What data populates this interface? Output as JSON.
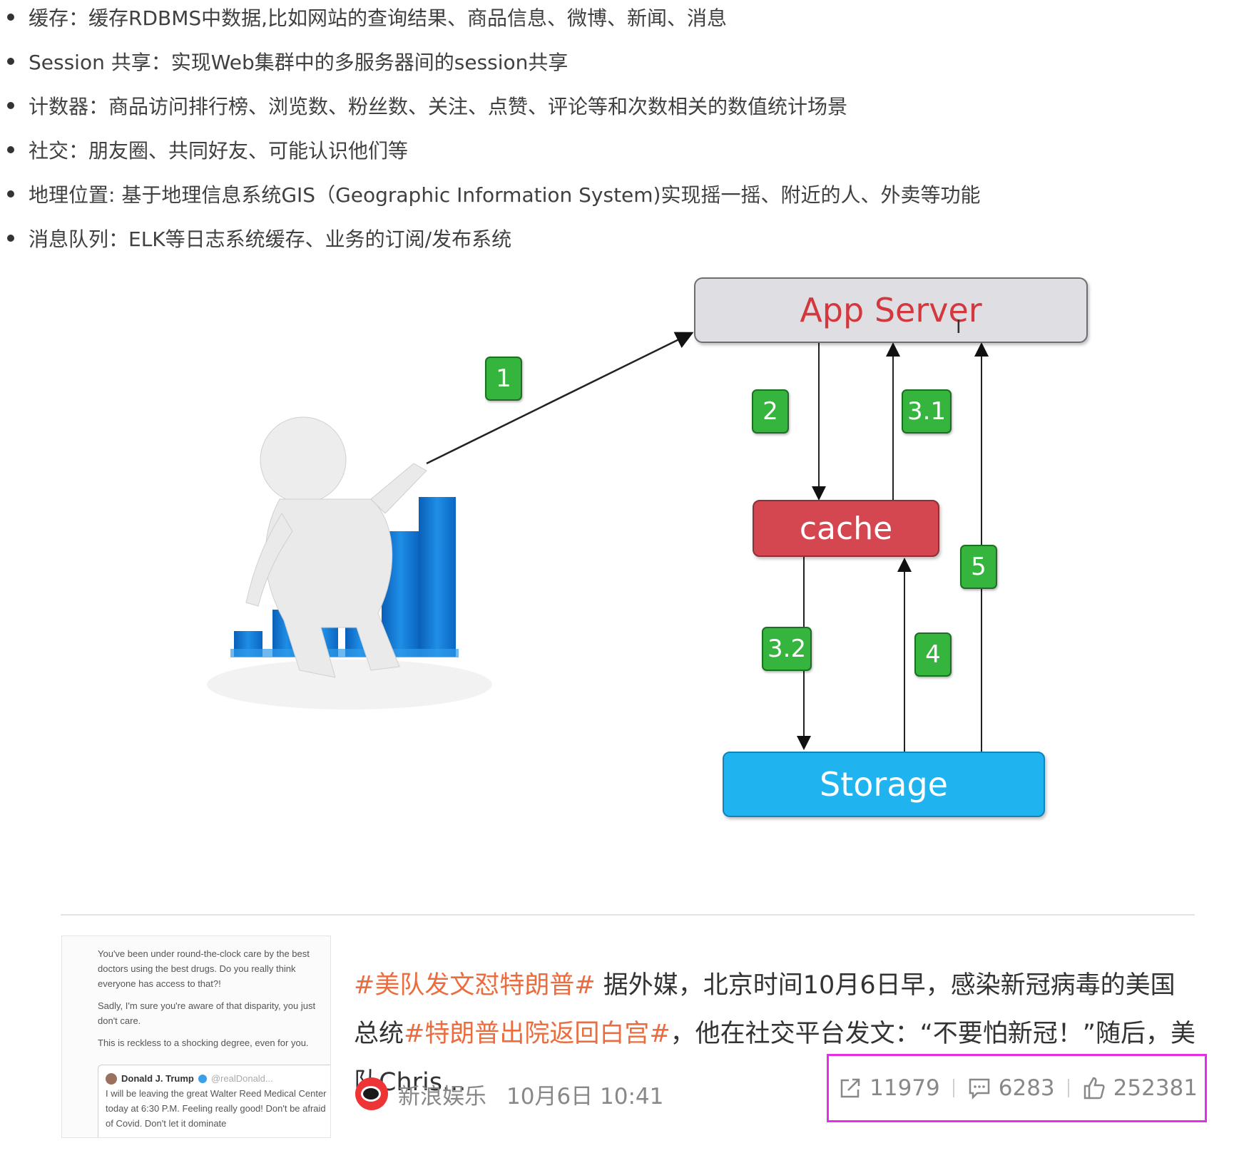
{
  "bullets": [
    "缓存：缓存RDBMS中数据,比如网站的查询结果、商品信息、微博、新闻、消息",
    "Session 共享：实现Web集群中的多服务器间的session共享",
    "计数器：商品访问排行榜、浏览数、粉丝数、关注、点赞、评论等和次数相关的数值统计场景",
    "社交：朋友圈、共同好友、可能认识他们等",
    "地理位置: 基于地理信息系统GIS（Geographic Information System)实现摇一摇、附近的人、外卖等功能",
    "消息队列：ELK等日志系统缓存、业务的订阅/发布系统"
  ],
  "diagram": {
    "app_server": "App Server",
    "cache": "cache",
    "storage": "Storage",
    "steps": [
      "1",
      "2",
      "3.1",
      "3.2",
      "4",
      "5"
    ],
    "colors": {
      "app_server_text": "#d3383e",
      "cache": "#d54750",
      "storage": "#1fb4f0",
      "step": "#35b53d",
      "bars": "#1a7fd8"
    }
  },
  "news": {
    "thumbnail_text": [
      "You've been under round-the-clock care by the best doctors using the best drugs. Do you really think everyone has access to that?!",
      "Sadly, I'm sure you're aware of that disparity, you just don't care.",
      "This is reckless to a shocking degree, even for you."
    ],
    "tweet_author": "Donald J. Trump",
    "tweet_handle": "@realDonald...",
    "tweet_text": "I will be leaving the great Walter Reed Medical Center today at 6:30 P.M. Feeling really good! Don't be afraid of Covid. Don't let it dominate",
    "tag1": "#美队发文怼特朗普#",
    "text1": " 据外媒，北京时间10月6日早，感染新冠病毒的美国总统",
    "tag2": "#特朗普出院返回白宫#",
    "text2": "，他在社交平台发文：“不要怕新冠！”随后，美队Chris...",
    "source": "新浪娱乐",
    "time": "10月6日 10:41",
    "shares": "11979",
    "comments": "6283",
    "likes": "252381",
    "highlight_color": "#e62de6"
  }
}
